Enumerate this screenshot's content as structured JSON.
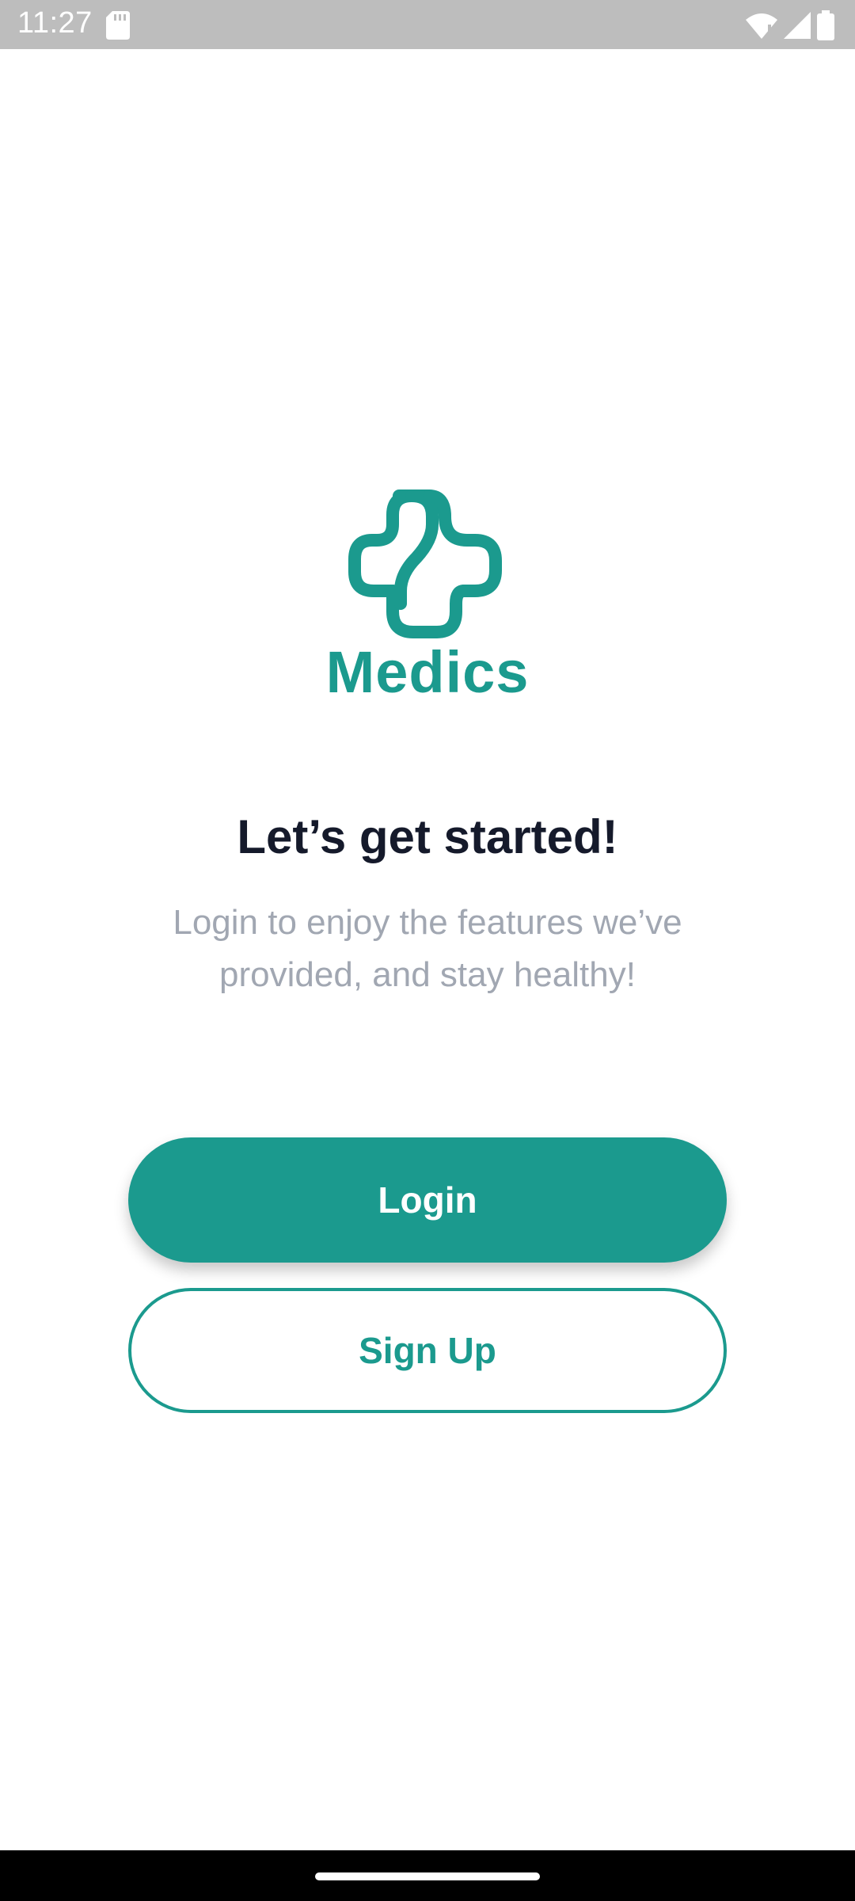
{
  "status_bar": {
    "time": "11:27",
    "icons": [
      "sd-card-icon",
      "wifi-icon",
      "signal-icon",
      "battery-icon"
    ]
  },
  "brand": {
    "name": "Medics",
    "logo_icon": "medical-cross-icon",
    "color": "#1b9a8e"
  },
  "welcome": {
    "heading": "Let’s get started!",
    "subtitle": "Login to enjoy the features we’ve provided, and stay healthy!"
  },
  "actions": {
    "login_label": "Login",
    "signup_label": "Sign Up"
  },
  "colors": {
    "accent": "#1b9a8e",
    "heading_text": "#151a2b",
    "muted_text": "#a1a7b2",
    "status_bar": "#bdbdbd"
  }
}
